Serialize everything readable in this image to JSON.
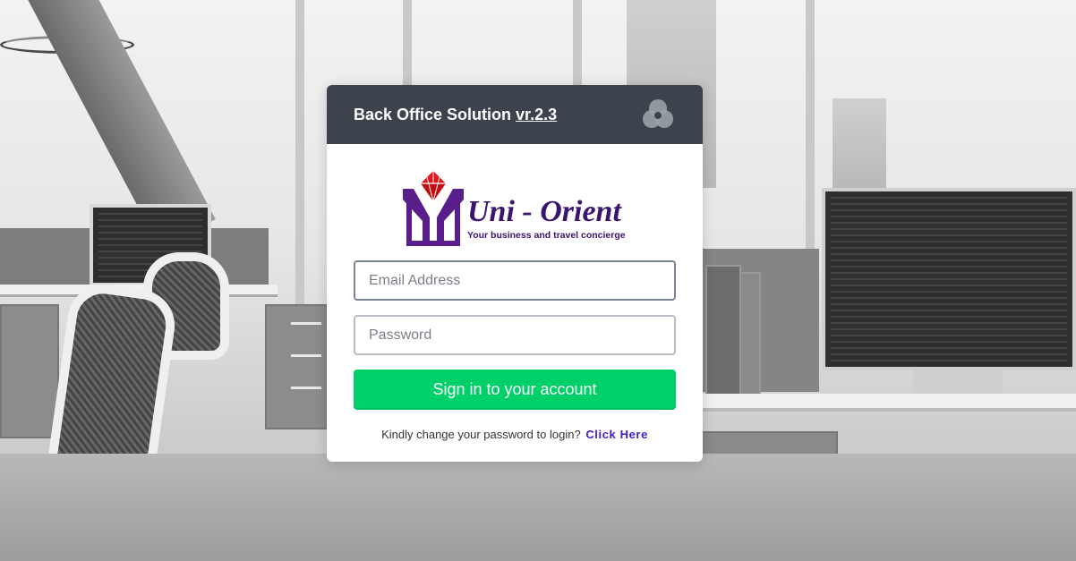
{
  "header": {
    "title": "Back Office Solution",
    "version": "vr.2.3",
    "icon": "three-circles-icon"
  },
  "logo": {
    "brand": "Uni - Orient",
    "tagline": "Your business and travel concierge"
  },
  "form": {
    "email_placeholder": "Email Address",
    "password_placeholder": "Password",
    "submit_label": "Sign in to your account",
    "note_text": "Kindly change your password to login?",
    "note_link": "Click Here"
  },
  "colors": {
    "header_bg": "#3d434c",
    "button_bg": "#00d06a",
    "link": "#3f1ad1",
    "logo_red": "#e4161b",
    "logo_purple": "#5a1e8c"
  }
}
